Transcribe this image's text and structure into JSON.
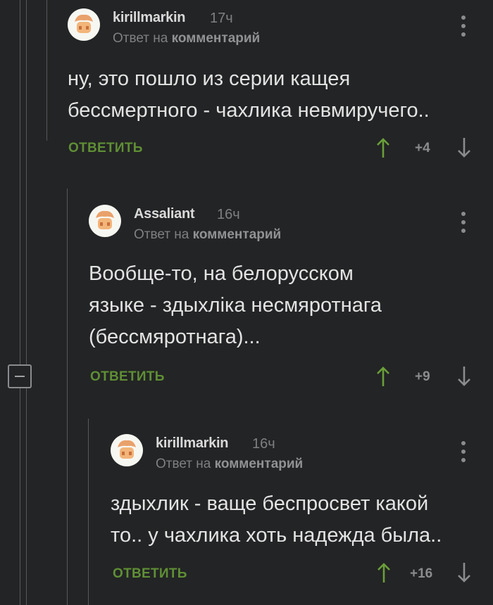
{
  "comments": [
    {
      "author": "kirillmarkin",
      "time": "17ч",
      "reply_to_prefix": "Ответ на",
      "reply_to_link": "комментарий",
      "lines": [
        "ну, это пошло из серии кащея",
        "бессмертного - чахлика невмиручего.."
      ],
      "reply_label": "ОТВЕТИТЬ",
      "score": "+4"
    },
    {
      "author": "Assaliant",
      "time": "16ч",
      "reply_to_prefix": "Ответ на",
      "reply_to_link": "комментарий",
      "lines": [
        "Вообще-то, на белорусском",
        "языке - здыхліка несмяротнага",
        "(бессмяротнага)..."
      ],
      "reply_label": "ОТВЕТИТЬ",
      "score": "+9"
    },
    {
      "author": "kirillmarkin",
      "time": "16ч",
      "reply_to_prefix": "Ответ на",
      "reply_to_link": "комментарий",
      "lines": [
        "здыхлик - ваще беспросвет какой",
        "то.. у чахлика хоть надежда была.."
      ],
      "reply_label": "ОТВЕТИТЬ",
      "score": "+16"
    }
  ],
  "colors": {
    "background": "#232425",
    "reply_green": "#5f8f35",
    "upvote_green": "#6a9f3a",
    "muted": "#7e8081",
    "text": "#e3e3e3"
  },
  "icons": [
    "avatar-icon",
    "more-options-icon",
    "upvote-arrow-icon",
    "downvote-arrow-icon",
    "collapse-thread-icon"
  ]
}
